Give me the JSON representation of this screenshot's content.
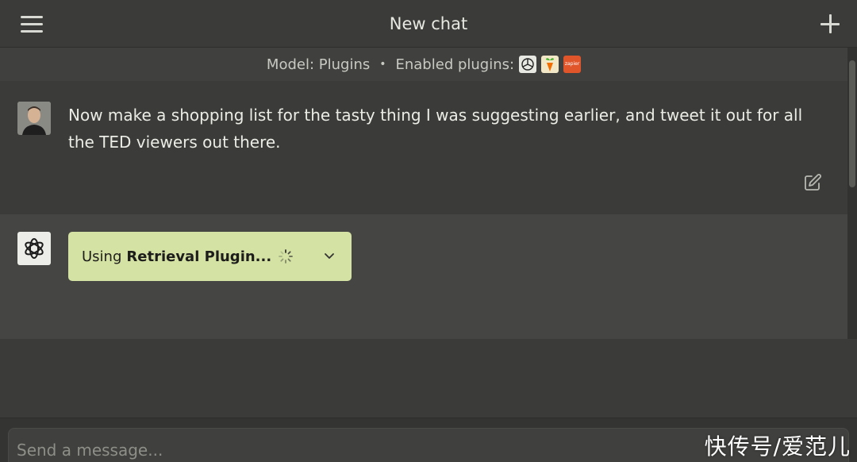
{
  "header": {
    "title": "New chat",
    "menu_icon": "hamburger-menu-icon",
    "new_chat_icon": "plus-icon"
  },
  "model_bar": {
    "model_text": "Model: Plugins",
    "separator": "•",
    "plugins_label": "Enabled plugins:",
    "plugins": [
      {
        "name": "openai-plugin-icon"
      },
      {
        "name": "instacart-plugin-icon"
      },
      {
        "name": "zapier-plugin-icon",
        "label": "zapier"
      }
    ]
  },
  "conversation": {
    "user_message": "Now make a shopping list for the tasty thing I was suggesting earlier, and tweet it out for all the TED viewers out there.",
    "assistant": {
      "using_prefix": "Using",
      "plugin_name": "Retrieval Plugin...",
      "status": "loading",
      "card_color": "#d4e2a4"
    }
  },
  "composer": {
    "placeholder": "Send a message..."
  },
  "watermark": "快传号/爱范儿"
}
